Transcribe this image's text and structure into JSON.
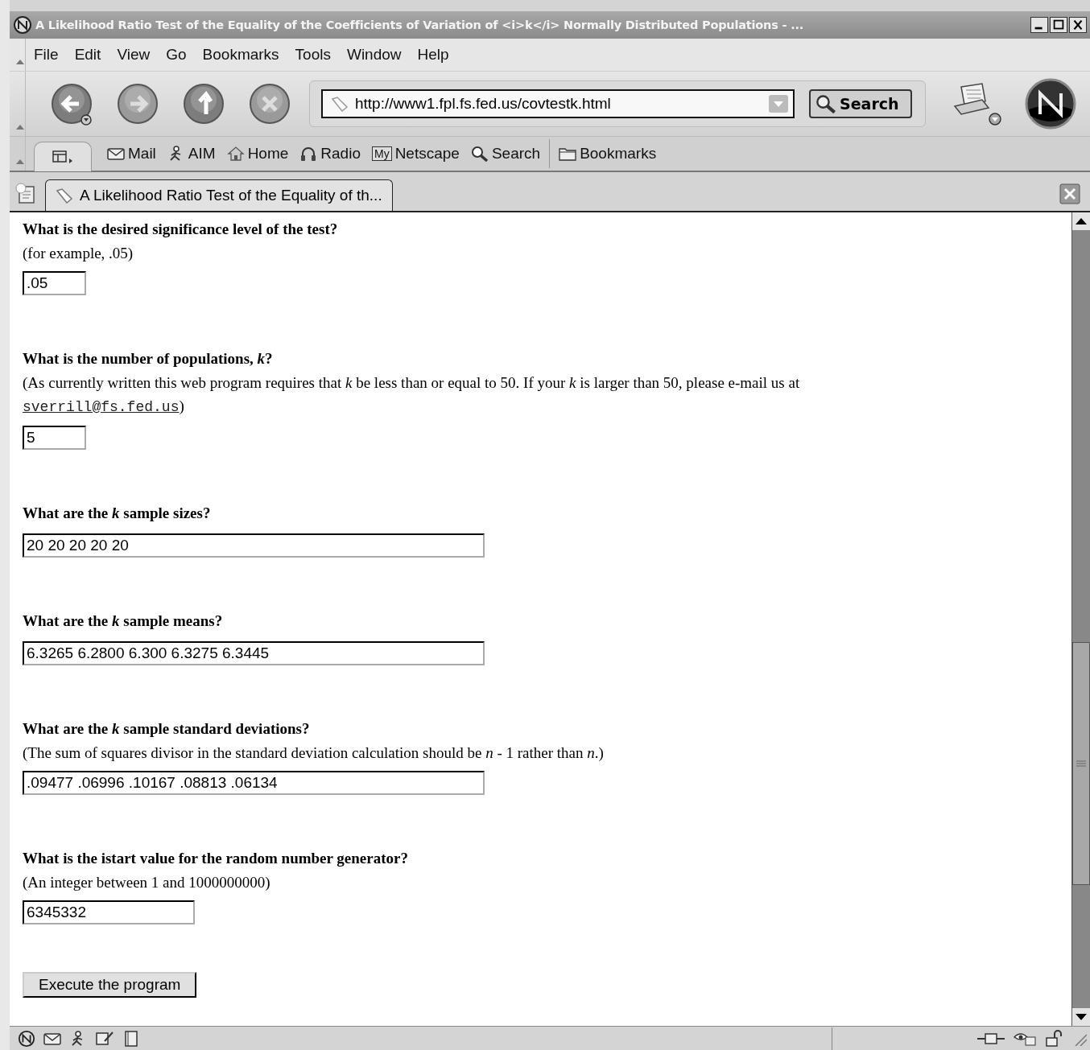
{
  "window": {
    "title": "A Likelihood Ratio Test of the Equality of the Coefficients of Variation of <i>k</i> Normally Distributed Populations - ..."
  },
  "menu": [
    "File",
    "Edit",
    "View",
    "Go",
    "Bookmarks",
    "Tools",
    "Window",
    "Help"
  ],
  "navigation": {
    "url": "http://www1.fpl.fs.fed.us/covtestk.html",
    "search_button": "Search"
  },
  "personal_toolbar": [
    {
      "kind": "mail",
      "label": "Mail"
    },
    {
      "kind": "aim",
      "label": "AIM"
    },
    {
      "kind": "home",
      "label": "Home"
    },
    {
      "kind": "radio",
      "label": "Radio"
    },
    {
      "kind": "my",
      "label": "Netscape",
      "icon_text": "My"
    },
    {
      "kind": "search",
      "label": "Search"
    },
    {
      "kind": "bookmarks",
      "label": "Bookmarks"
    }
  ],
  "tabs": [
    {
      "label": "A Likelihood Ratio Test of the Equality of th...",
      "selected": true
    }
  ],
  "form": {
    "questions": [
      {
        "question": "What is the desired significance level of the test?",
        "note": "(for example, .05)",
        "value": ".05",
        "kind": "short"
      },
      {
        "question": "What is the number of populations, *k*?",
        "note": "(As currently written this web program requires that *k* be less than or equal to 50. If your *k* is larger than 50, please e-mail us at",
        "link": "sverrill@fs.fed.us",
        "note_end": ")",
        "value": "5",
        "kind": "short"
      },
      {
        "question": "What are the *k* sample sizes?",
        "value": "20 20 20 20 20",
        "kind": "long"
      },
      {
        "question": "What are the *k* sample means?",
        "value": "6.3265 6.2800 6.300 6.3275 6.3445",
        "kind": "long"
      },
      {
        "question": "What are the *k* sample standard deviations?",
        "note": "(The sum of squares divisor in the standard deviation calculation should be *n* - 1 rather than *n*.)",
        "value": ".09477 .06996 .10167 .08813 .06134",
        "kind": "long"
      },
      {
        "question": "What is the istart value for the random number generator?",
        "note": "(An integer between 1 and 1000000000)",
        "value": "6345332",
        "kind": "medium"
      }
    ],
    "submit": "Execute the program"
  }
}
